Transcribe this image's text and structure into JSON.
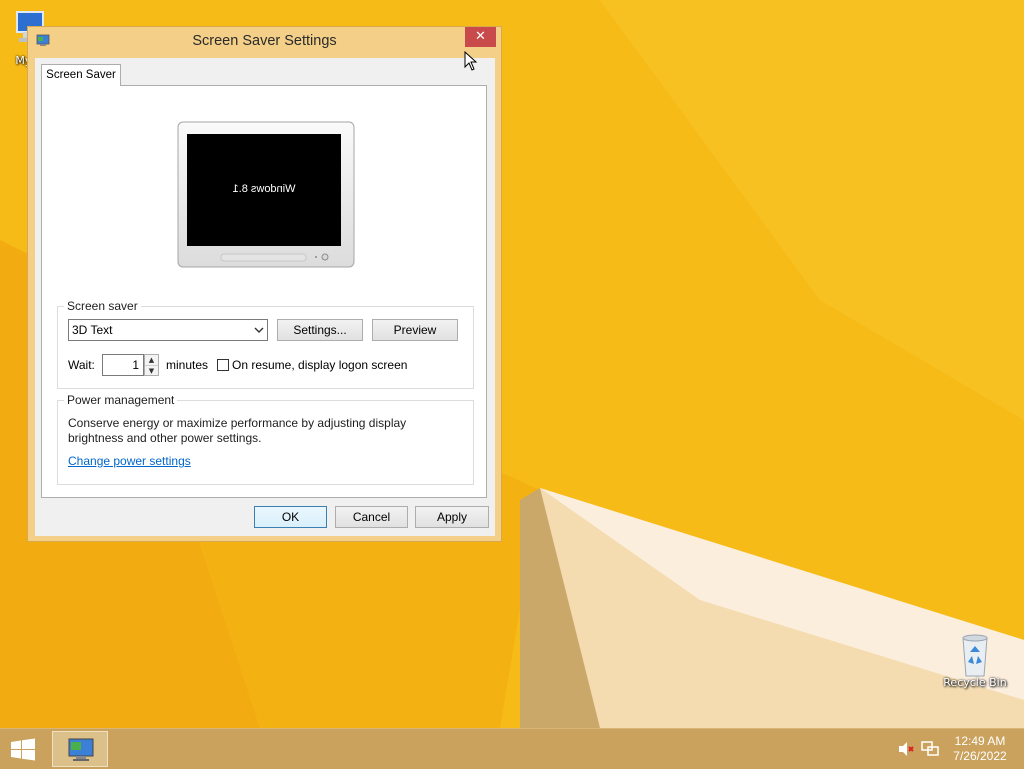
{
  "desktop": {
    "icons": [
      {
        "label": "My C"
      },
      {
        "label": "Recycle Bin"
      }
    ]
  },
  "dialog": {
    "title": "Screen Saver Settings",
    "close_glyph": "✕",
    "tab_label": "Screen Saver",
    "preview": {
      "screen_text": "Windows 8.1"
    },
    "screen_saver": {
      "group_label": "Screen saver",
      "selected": "3D Text",
      "settings_label": "Settings...",
      "preview_label": "Preview",
      "wait_label": "Wait:",
      "wait_value": "1",
      "minutes_label": "minutes",
      "resume_label": "On resume, display logon screen",
      "resume_checked": false
    },
    "power": {
      "group_label": "Power management",
      "description": "Conserve energy or maximize performance by adjusting display brightness and other power settings.",
      "link_label": "Change power settings"
    },
    "buttons": {
      "ok": "OK",
      "cancel": "Cancel",
      "apply": "Apply"
    }
  },
  "taskbar": {
    "time": "12:49 AM",
    "date": "7/26/2022",
    "items": [
      {
        "icon": "display-settings-icon"
      }
    ],
    "tray": [
      "volume-muted-icon",
      "network-icon"
    ]
  },
  "colors": {
    "wallpaper": "#f6b817",
    "taskbar": "#caa25d",
    "dialog_frame": "#f3cf88",
    "close_button": "#c94a4a",
    "link": "#0066cc"
  }
}
